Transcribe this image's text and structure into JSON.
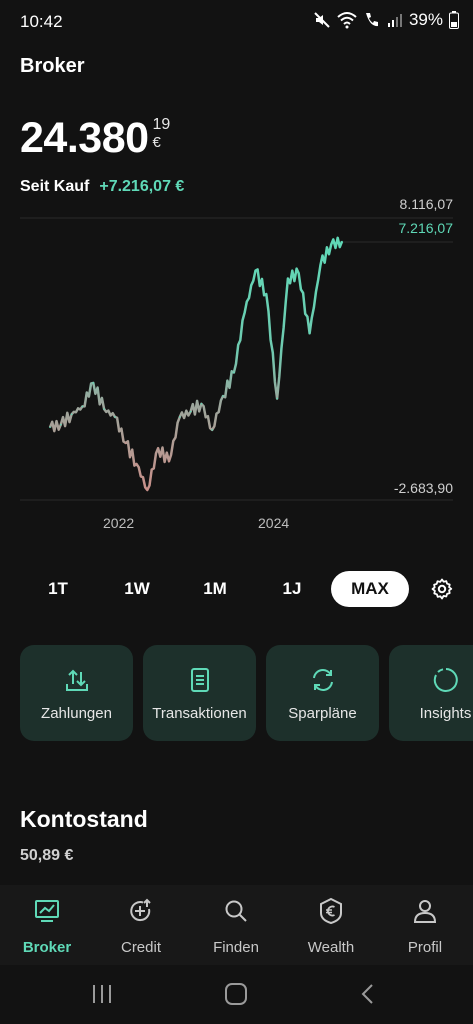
{
  "status_bar": {
    "time": "10:42",
    "battery": "39%",
    "icons": [
      "mute-icon",
      "wifi-icon",
      "wifi-call-icon",
      "signal-icon",
      "battery-icon"
    ]
  },
  "header": {
    "title": "Broker"
  },
  "balance": {
    "main": "24.380",
    "cents": "19",
    "currency": "€"
  },
  "performance": {
    "label": "Seit Kauf",
    "value": "+7.216,07 €"
  },
  "chart": {
    "max_label": "8.116,07",
    "current_label": "7.216,07",
    "min_label": "-2.683,90",
    "x_labels": [
      "2022",
      "2024"
    ],
    "colors": {
      "gain": "#5fd9b7",
      "loss": "#c9908a"
    }
  },
  "chart_data": {
    "type": "line",
    "x": [
      "2021-04",
      "2021-06",
      "2021-08",
      "2021-10",
      "2021-12",
      "2022-02",
      "2022-04",
      "2022-06",
      "2022-08",
      "2022-10",
      "2022-12",
      "2023-02",
      "2023-04",
      "2023-06",
      "2023-08",
      "2023-10",
      "2023-12",
      "2024-02",
      "2024-04",
      "2024-06",
      "2024-07",
      "2024-08",
      "2024-09",
      "2024-10",
      "2024-11",
      "2024-12",
      "2025-01",
      "2025-02"
    ],
    "y": [
      100,
      200,
      600,
      900,
      1800,
      800,
      500,
      -500,
      -1300,
      -2300,
      -700,
      -1200,
      500,
      700,
      1000,
      0,
      1300,
      2200,
      4500,
      6100,
      5200,
      1200,
      5800,
      6000,
      3700,
      6300,
      7100,
      7216.07
    ],
    "ylim": [
      -2683.9,
      8116.07
    ],
    "x_ticks": [
      "2022",
      "2024"
    ],
    "grid": false
  },
  "ranges": {
    "items": [
      "1T",
      "1W",
      "1M",
      "1J",
      "MAX"
    ],
    "active": "MAX"
  },
  "quick_actions": [
    {
      "label": "Zahlungen",
      "icon": "transfer-icon"
    },
    {
      "label": "Transaktionen",
      "icon": "receipt-icon"
    },
    {
      "label": "Sparpläne",
      "icon": "refresh-icon"
    },
    {
      "label": "Insights",
      "icon": "donut-chart-icon"
    }
  ],
  "account": {
    "title": "Kontostand",
    "value": "50,89 €"
  },
  "tabs": [
    {
      "label": "Broker",
      "icon": "chart-monitor-icon",
      "active": true
    },
    {
      "label": "Credit",
      "icon": "credit-icon",
      "active": false
    },
    {
      "label": "Finden",
      "icon": "search-icon",
      "active": false
    },
    {
      "label": "Wealth",
      "icon": "euro-shield-icon",
      "active": false
    },
    {
      "label": "Profil",
      "icon": "person-icon",
      "active": false
    }
  ]
}
